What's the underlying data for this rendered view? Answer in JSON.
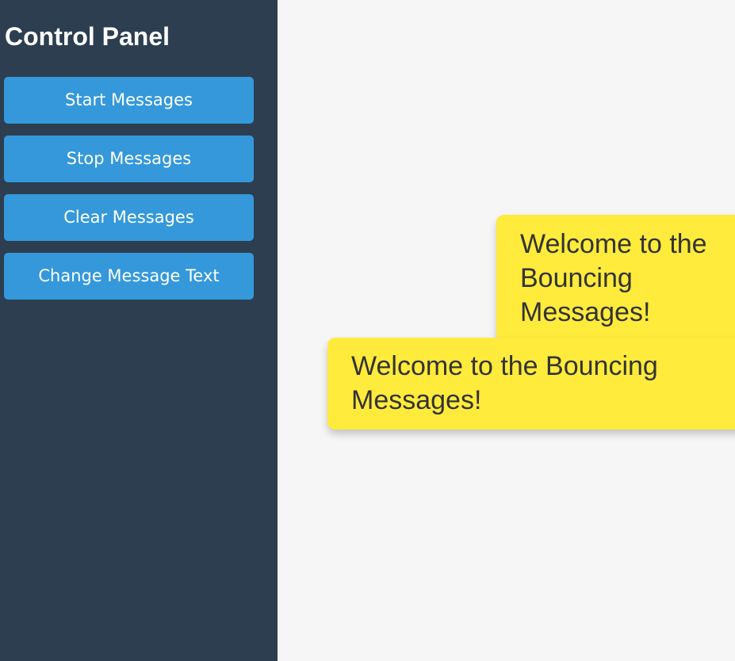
{
  "sidebar": {
    "title": "Control Panel",
    "buttons": {
      "start": "Start Messages",
      "stop": "Stop Messages",
      "clear": "Clear Messages",
      "change": "Change Message Text"
    }
  },
  "main": {
    "messages": [
      {
        "text": "Welcome to the Bouncing Messages!"
      },
      {
        "text": "Welcome to the Bouncing Messages!"
      }
    ]
  },
  "colors": {
    "sidebar_bg": "#2c3e50",
    "button_bg": "#3498db",
    "message_bg": "#ffeb3b",
    "main_bg": "#f6f6f6"
  }
}
